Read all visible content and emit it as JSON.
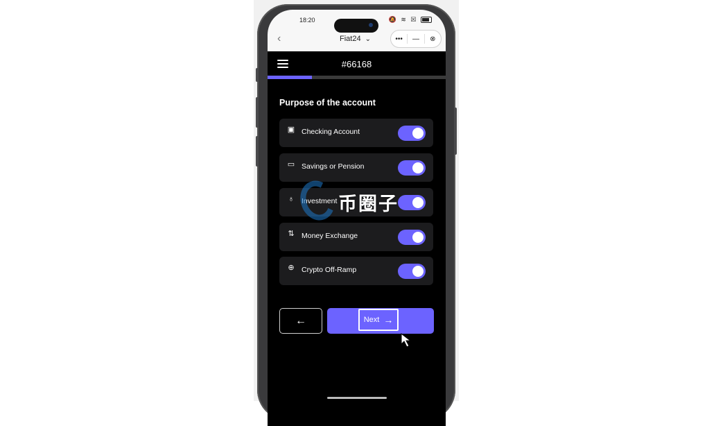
{
  "status_bar": {
    "time": "18:20",
    "icons": "🔕 ≋ ☒"
  },
  "mini_program_bar": {
    "back_icon": "‹",
    "title": "Fiat24",
    "title_chevron": "⌄",
    "more_label": "•••",
    "minimize_label": "—",
    "close_label": "⊗"
  },
  "app_header": {
    "account_id": "#66168",
    "progress_fraction": 0.25
  },
  "section": {
    "title": "Purpose of the account"
  },
  "options": [
    {
      "icon": "money-icon",
      "glyph": "▣",
      "label": "Checking Account",
      "enabled": true
    },
    {
      "icon": "wallet-icon",
      "glyph": "▭",
      "label": "Savings or Pension",
      "enabled": true
    },
    {
      "icon": "trophy-icon",
      "glyph": "♁",
      "label": "Investment",
      "enabled": true
    },
    {
      "icon": "exchange-icon",
      "glyph": "⇅",
      "label": "Money Exchange",
      "enabled": true
    },
    {
      "icon": "globe-icon",
      "glyph": "⊕",
      "label": "Crypto Off-Ramp",
      "enabled": true
    }
  ],
  "buttons": {
    "back_glyph": "←",
    "next_label": "Next",
    "next_glyph": "→"
  },
  "watermark": {
    "text": "币圈子"
  },
  "colors": {
    "accent": "#6c63ff",
    "row_bg": "#1c1c1e",
    "screen_bg": "#000000"
  }
}
